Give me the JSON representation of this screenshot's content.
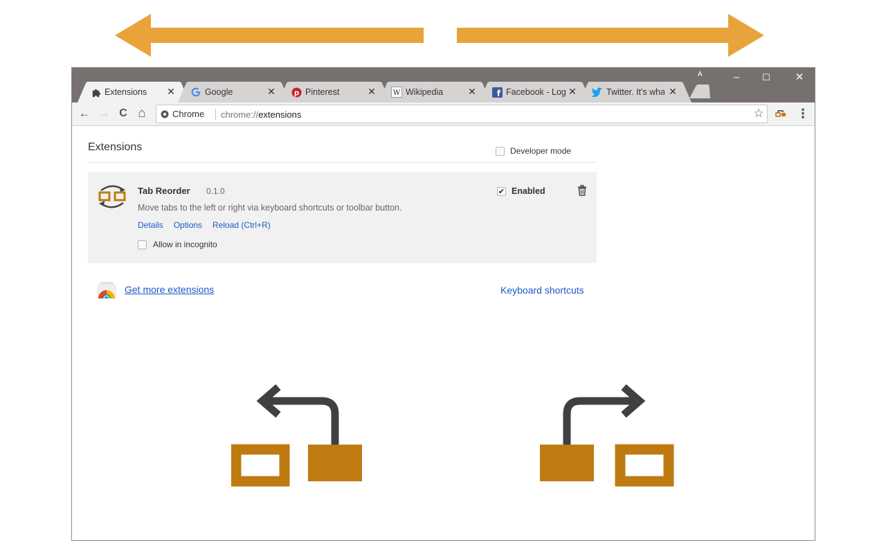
{
  "colors": {
    "accent": "#E8A33A",
    "illustration_box": "#C07A12",
    "illustration_arrow": "#404040",
    "titlebar": "#76716F",
    "link": "#1A59C8"
  },
  "window": {
    "profile_badge": "A",
    "controls": {
      "minimize": "–",
      "maximize": "☐",
      "close": "✕"
    }
  },
  "tabs": [
    {
      "title": "Extensions",
      "icon": "puzzle-icon",
      "active": true,
      "close": "✕"
    },
    {
      "title": "Google",
      "icon": "google-icon",
      "active": false,
      "close": "✕"
    },
    {
      "title": "Pinterest",
      "icon": "pinterest-icon",
      "active": false,
      "close": "✕"
    },
    {
      "title": "Wikipedia",
      "icon": "wikipedia-icon",
      "active": false,
      "close": "✕"
    },
    {
      "title": "Facebook - Log",
      "icon": "facebook-icon",
      "active": false,
      "close": "✕"
    },
    {
      "title": "Twitter. It's what",
      "icon": "twitter-icon",
      "active": false,
      "close": "✕"
    }
  ],
  "toolbar": {
    "back": "←",
    "forward": "→",
    "reload": "C",
    "home": "⌂",
    "chip_label": "Chrome",
    "url_scheme": "chrome://",
    "url_path": "extensions",
    "star": "☆",
    "menu": "⋮"
  },
  "page": {
    "title": "Extensions",
    "developer_mode_label": "Developer mode",
    "developer_mode_checked": false,
    "extension": {
      "name": "Tab Reorder",
      "version": "0.1.0",
      "description": "Move tabs to the left or right via keyboard shortcuts or toolbar button.",
      "links": [
        "Details",
        "Options",
        "Reload (Ctrl+R)"
      ],
      "incognito_label": "Allow in incognito",
      "incognito_checked": false,
      "enabled_label": "Enabled",
      "enabled_checked": true
    },
    "get_more_label": "Get more extensions",
    "keyboard_shortcuts_label": "Keyboard shortcuts"
  }
}
